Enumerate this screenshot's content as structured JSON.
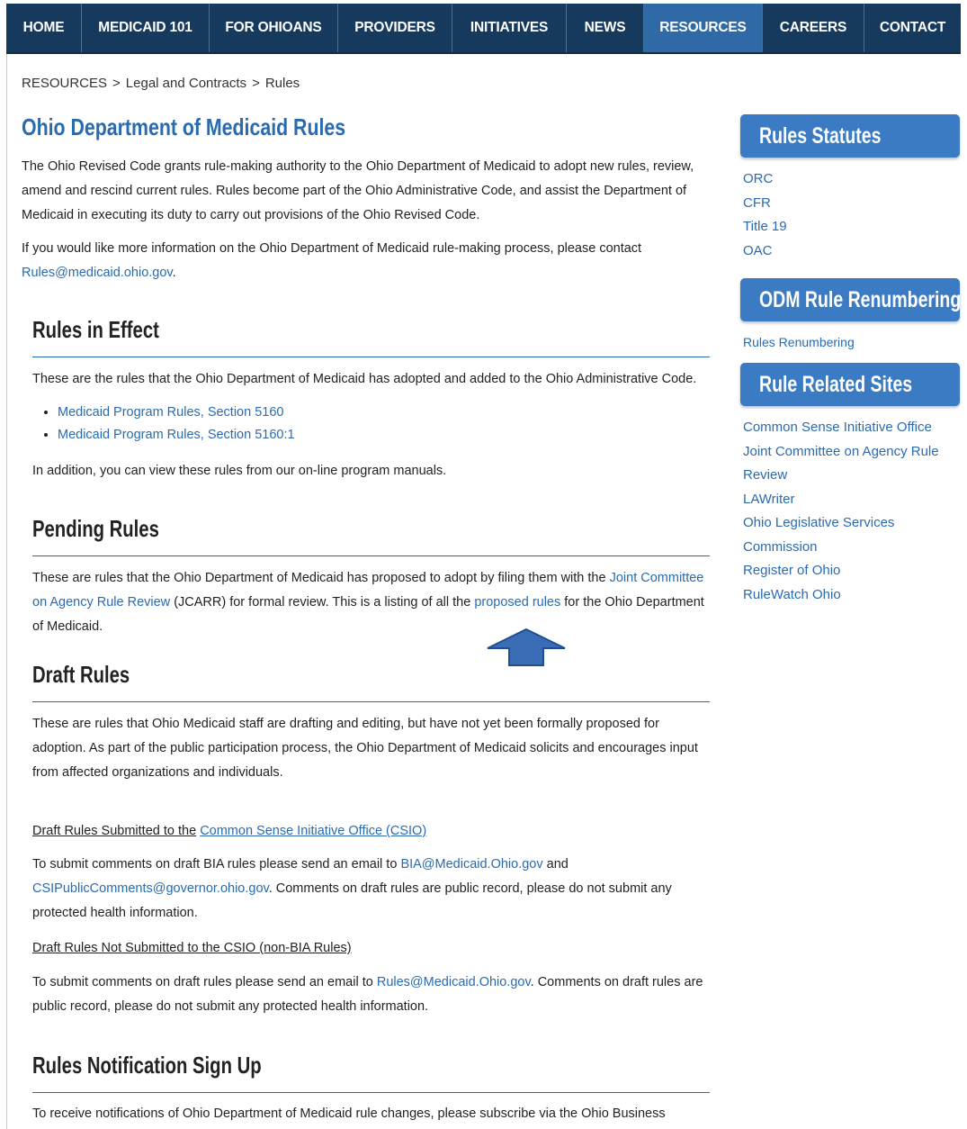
{
  "nav": {
    "items": [
      {
        "label": "HOME",
        "width": 84
      },
      {
        "label": "MEDICAID 101",
        "width": 142
      },
      {
        "label": "FOR OHIOANS",
        "width": 143
      },
      {
        "label": "PROVIDERS",
        "width": 127
      },
      {
        "label": "INITIATIVES",
        "width": 127
      },
      {
        "label": "NEWS",
        "width": 86
      },
      {
        "label": "RESOURCES",
        "width": 132
      },
      {
        "label": "CAREERS",
        "width": 113
      },
      {
        "label": "CONTACT",
        "width": 107
      }
    ],
    "active": "RESOURCES"
  },
  "breadcrumb": {
    "items": [
      "RESOURCES",
      "Legal and Contracts",
      "Rules"
    ],
    "separator": ">"
  },
  "page_title": "Ohio Department of Medicaid Rules",
  "intro": {
    "p1": "The Ohio Revised Code grants rule-making authority to the Ohio Department of Medicaid to adopt new rules, review, amend and rescind current rules. Rules become part of the Ohio Administrative Code, and assist the Department of Medicaid in executing its duty to carry out provisions of the Ohio Revised Code.",
    "p2_text": "If you would like more information on the Ohio Department of Medicaid rule-making process, please contact",
    "p2_link": "Rules@medicaid.ohio.gov",
    "p2_end": "."
  },
  "rules_in_effect": {
    "heading": "Rules in Effect",
    "text": "These are the rules that the Ohio Department of Medicaid has adopted and added to the Ohio Administrative Code.",
    "links": [
      "Medicaid Program Rules, Section 5160",
      "Medicaid Program Rules, Section 5160:1"
    ],
    "note": "In addition, you can view these rules from our on-line program manuals."
  },
  "pending_rules": {
    "heading": "Pending Rules",
    "t1": "These are rules that the Ohio Department of Medicaid has proposed to adopt by filing them with the",
    "l1": "Joint Committee on Agency Rule Review",
    "t2": "(JCARR) for formal review. This is a listing of all the",
    "l2": "proposed rules",
    "t3": "for the Ohio Department of Medicaid."
  },
  "draft_rules": {
    "heading": "Draft Rules",
    "text": "These are rules that Ohio Medicaid staff are drafting and editing, but have not yet been formally proposed for adoption. As part of the public participation process, the Ohio Department of Medicaid solicits and encourages input from affected organizations and individuals.",
    "csio_title_text": "Draft Rules Submitted to the",
    "csio_title_link": "Common Sense Initiative Office (CSIO)",
    "csio_t1": "To submit comments on draft BIA rules please send an email to",
    "csio_l1": "BIA@Medicaid.Ohio.gov",
    "csio_t2": "and",
    "csio_l2": "CSIPublicComments@governor.ohio.gov",
    "csio_t3": ". Comments on draft rules are public record, please do not submit any protected health information.",
    "nonbia_title": "Draft Rules Not Submitted to the CSIO (non-BIA Rules)",
    "nonbia_t1": "To submit comments on draft rules please send an email to",
    "nonbia_l1": "Rules@Medicaid.Ohio.gov",
    "nonbia_t2": ". Comments on draft rules are public record, please do not submit any protected health information."
  },
  "notification": {
    "heading": "Rules Notification Sign Up",
    "text": "To receive notifications of  Ohio Department of Medicaid  rule changes, please subscribe via the Ohio Business"
  },
  "sidebar": {
    "statutes": {
      "heading": "Rules Statutes",
      "links": [
        "ORC",
        "CFR",
        "Title 19",
        "OAC"
      ]
    },
    "renumbering": {
      "heading": "ODM Rule Renumbering",
      "links": [
        "Rules Renumbering"
      ]
    },
    "related": {
      "heading": "Rule Related Sites",
      "links": [
        "Common Sense Initiative Office",
        "Joint Committee on Agency Rule Review",
        "LAWriter",
        "Ohio Legislative Services Commission",
        "Register of Ohio",
        "RuleWatch Ohio"
      ]
    }
  },
  "colors": {
    "nav_bg": "#163a5e",
    "nav_active": "#2f6aa7",
    "link": "#2a6bb0",
    "sidebar_head": "#3a7bc3",
    "arrow": "#3a6db5"
  }
}
